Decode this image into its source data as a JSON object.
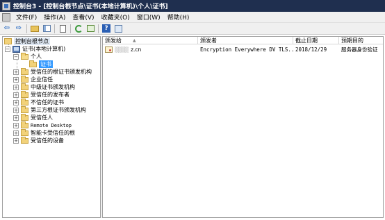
{
  "window": {
    "title": "控制台3 - [控制台根节点\\证书(本地计算机)\\个人\\证书]"
  },
  "menu": {
    "items": [
      {
        "label": "文件(F)"
      },
      {
        "label": "操作(A)"
      },
      {
        "label": "查看(V)"
      },
      {
        "label": "收藏夹(O)"
      },
      {
        "label": "窗口(W)"
      },
      {
        "label": "帮助(H)"
      }
    ]
  },
  "toolbar": {
    "buttons": [
      "back-icon",
      "forward-icon",
      "up-folder-icon",
      "show-hide-tree-icon",
      "copy-icon",
      "refresh-icon",
      "export-list-icon",
      "help-icon",
      "properties-icon"
    ],
    "back_glyph": "⇦",
    "forward_glyph": "⇨",
    "help_glyph": "?"
  },
  "tree": {
    "root": "控制台根节点",
    "computer": "证书(本地计算机)",
    "personal": "个人",
    "certs_selected": "证书",
    "children": [
      "受信任的根证书颁发机构",
      "企业信任",
      "中级证书颁发机构",
      "受信任的发布者",
      "不信任的证书",
      "第三方根证书颁发机构",
      "受信任人",
      "Remote Desktop",
      "智能卡受信任的根",
      "受信任的设备"
    ],
    "expander_glyph": "+",
    "collapse_glyph": "−"
  },
  "list": {
    "columns": [
      {
        "label": "颁发给"
      },
      {
        "label": "颁发者"
      },
      {
        "label": "截止日期"
      },
      {
        "label": "预期目的"
      }
    ],
    "sort_glyph": "▲",
    "rows": [
      {
        "issued_to_masked": "▒▒▒▒",
        "issued_to": "z.cn",
        "issued_by": "Encryption Everywhere DV TLS...",
        "expires": "2018/12/29",
        "purpose": "服务器身份验证"
      }
    ]
  },
  "colors": {
    "titlebar": "#1f2f4f",
    "selection": "#3399ff",
    "chrome": "#f0f0f0"
  }
}
